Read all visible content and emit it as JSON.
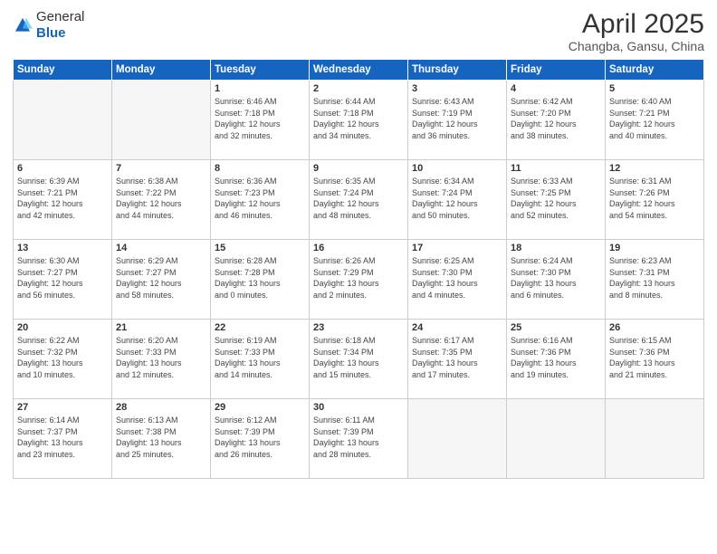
{
  "logo": {
    "general": "General",
    "blue": "Blue"
  },
  "title": "April 2025",
  "subtitle": "Changba, Gansu, China",
  "headers": [
    "Sunday",
    "Monday",
    "Tuesday",
    "Wednesday",
    "Thursday",
    "Friday",
    "Saturday"
  ],
  "weeks": [
    [
      {
        "day": "",
        "detail": ""
      },
      {
        "day": "",
        "detail": ""
      },
      {
        "day": "1",
        "detail": "Sunrise: 6:46 AM\nSunset: 7:18 PM\nDaylight: 12 hours\nand 32 minutes."
      },
      {
        "day": "2",
        "detail": "Sunrise: 6:44 AM\nSunset: 7:18 PM\nDaylight: 12 hours\nand 34 minutes."
      },
      {
        "day": "3",
        "detail": "Sunrise: 6:43 AM\nSunset: 7:19 PM\nDaylight: 12 hours\nand 36 minutes."
      },
      {
        "day": "4",
        "detail": "Sunrise: 6:42 AM\nSunset: 7:20 PM\nDaylight: 12 hours\nand 38 minutes."
      },
      {
        "day": "5",
        "detail": "Sunrise: 6:40 AM\nSunset: 7:21 PM\nDaylight: 12 hours\nand 40 minutes."
      }
    ],
    [
      {
        "day": "6",
        "detail": "Sunrise: 6:39 AM\nSunset: 7:21 PM\nDaylight: 12 hours\nand 42 minutes."
      },
      {
        "day": "7",
        "detail": "Sunrise: 6:38 AM\nSunset: 7:22 PM\nDaylight: 12 hours\nand 44 minutes."
      },
      {
        "day": "8",
        "detail": "Sunrise: 6:36 AM\nSunset: 7:23 PM\nDaylight: 12 hours\nand 46 minutes."
      },
      {
        "day": "9",
        "detail": "Sunrise: 6:35 AM\nSunset: 7:24 PM\nDaylight: 12 hours\nand 48 minutes."
      },
      {
        "day": "10",
        "detail": "Sunrise: 6:34 AM\nSunset: 7:24 PM\nDaylight: 12 hours\nand 50 minutes."
      },
      {
        "day": "11",
        "detail": "Sunrise: 6:33 AM\nSunset: 7:25 PM\nDaylight: 12 hours\nand 52 minutes."
      },
      {
        "day": "12",
        "detail": "Sunrise: 6:31 AM\nSunset: 7:26 PM\nDaylight: 12 hours\nand 54 minutes."
      }
    ],
    [
      {
        "day": "13",
        "detail": "Sunrise: 6:30 AM\nSunset: 7:27 PM\nDaylight: 12 hours\nand 56 minutes."
      },
      {
        "day": "14",
        "detail": "Sunrise: 6:29 AM\nSunset: 7:27 PM\nDaylight: 12 hours\nand 58 minutes."
      },
      {
        "day": "15",
        "detail": "Sunrise: 6:28 AM\nSunset: 7:28 PM\nDaylight: 13 hours\nand 0 minutes."
      },
      {
        "day": "16",
        "detail": "Sunrise: 6:26 AM\nSunset: 7:29 PM\nDaylight: 13 hours\nand 2 minutes."
      },
      {
        "day": "17",
        "detail": "Sunrise: 6:25 AM\nSunset: 7:30 PM\nDaylight: 13 hours\nand 4 minutes."
      },
      {
        "day": "18",
        "detail": "Sunrise: 6:24 AM\nSunset: 7:30 PM\nDaylight: 13 hours\nand 6 minutes."
      },
      {
        "day": "19",
        "detail": "Sunrise: 6:23 AM\nSunset: 7:31 PM\nDaylight: 13 hours\nand 8 minutes."
      }
    ],
    [
      {
        "day": "20",
        "detail": "Sunrise: 6:22 AM\nSunset: 7:32 PM\nDaylight: 13 hours\nand 10 minutes."
      },
      {
        "day": "21",
        "detail": "Sunrise: 6:20 AM\nSunset: 7:33 PM\nDaylight: 13 hours\nand 12 minutes."
      },
      {
        "day": "22",
        "detail": "Sunrise: 6:19 AM\nSunset: 7:33 PM\nDaylight: 13 hours\nand 14 minutes."
      },
      {
        "day": "23",
        "detail": "Sunrise: 6:18 AM\nSunset: 7:34 PM\nDaylight: 13 hours\nand 15 minutes."
      },
      {
        "day": "24",
        "detail": "Sunrise: 6:17 AM\nSunset: 7:35 PM\nDaylight: 13 hours\nand 17 minutes."
      },
      {
        "day": "25",
        "detail": "Sunrise: 6:16 AM\nSunset: 7:36 PM\nDaylight: 13 hours\nand 19 minutes."
      },
      {
        "day": "26",
        "detail": "Sunrise: 6:15 AM\nSunset: 7:36 PM\nDaylight: 13 hours\nand 21 minutes."
      }
    ],
    [
      {
        "day": "27",
        "detail": "Sunrise: 6:14 AM\nSunset: 7:37 PM\nDaylight: 13 hours\nand 23 minutes."
      },
      {
        "day": "28",
        "detail": "Sunrise: 6:13 AM\nSunset: 7:38 PM\nDaylight: 13 hours\nand 25 minutes."
      },
      {
        "day": "29",
        "detail": "Sunrise: 6:12 AM\nSunset: 7:39 PM\nDaylight: 13 hours\nand 26 minutes."
      },
      {
        "day": "30",
        "detail": "Sunrise: 6:11 AM\nSunset: 7:39 PM\nDaylight: 13 hours\nand 28 minutes."
      },
      {
        "day": "",
        "detail": ""
      },
      {
        "day": "",
        "detail": ""
      },
      {
        "day": "",
        "detail": ""
      }
    ]
  ]
}
